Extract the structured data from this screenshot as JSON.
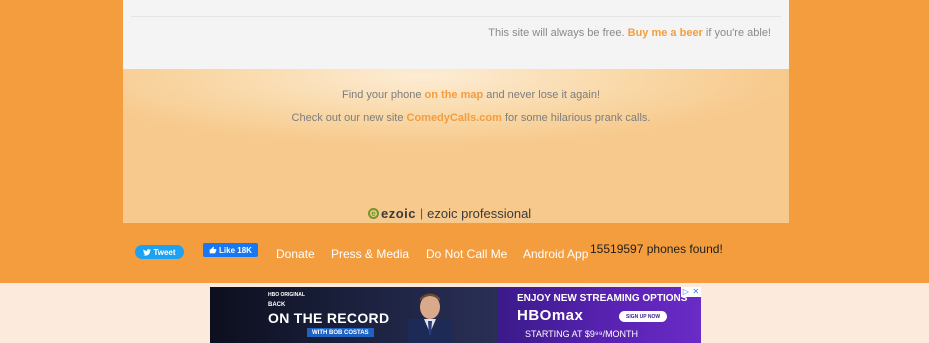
{
  "top_card": {
    "free_prefix": "This site will always be free.",
    "free_link": "Buy me a beer",
    "free_suffix": "if you're able!"
  },
  "promo": {
    "line1_prefix": "Find your phone",
    "line1_link": "on the map",
    "line1_suffix": "and never lose it again!",
    "line2_prefix": "Check out our new site",
    "line2_link": "ComedyCalls.com",
    "line2_suffix": "for some hilarious prank calls."
  },
  "ezoic": {
    "logo": "ezoic",
    "separator": "|",
    "tag": "ezoic professional"
  },
  "footer": {
    "tweet_label": "Tweet",
    "like_label": "Like 18K",
    "nav": [
      "Donate",
      "Press & Media",
      "Do Not Call Me",
      "Android App"
    ],
    "count_text": "15519597 phones found!"
  },
  "ad": {
    "left_brand": "HBO ORIGINAL",
    "left_kicker": "BACK",
    "left_title": "ON THE RECORD",
    "left_host": "WITH BOB COSTAS",
    "right_headline": "ENJOY NEW STREAMING OPTIONS",
    "right_brand": "HBOmax",
    "right_cta": "SIGN UP NOW",
    "right_price": "STARTING AT $9⁹⁹/MONTH"
  },
  "colors": {
    "accent": "#f39d3f",
    "cream": "#fcebdd",
    "twitter": "#1da1f2",
    "facebook": "#1877f2"
  },
  "icons": [
    "twitter-bird-icon",
    "thumbs-up-icon",
    "ad-choices-icon",
    "ad-close-icon"
  ]
}
